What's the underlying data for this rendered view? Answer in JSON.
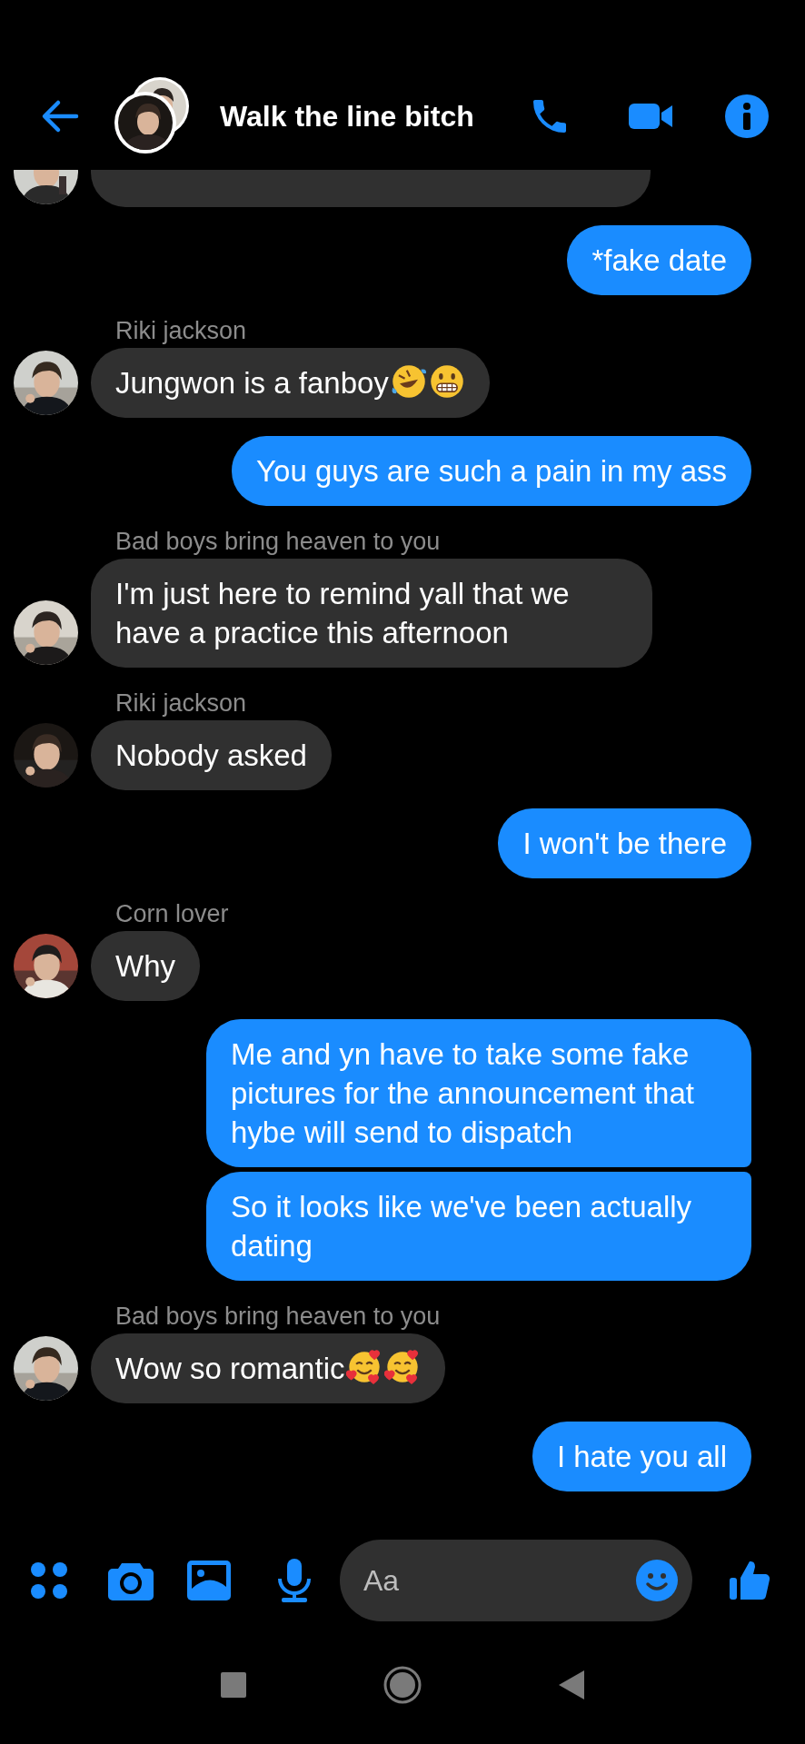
{
  "header": {
    "title": "Walk the line bitch"
  },
  "messages": [
    {
      "kind": "incoming",
      "cut_off": true
    },
    {
      "kind": "outgoing",
      "text": "*fake date"
    },
    {
      "kind": "incoming",
      "sender": "Riki jackson",
      "text": "Jungwon is a fanboy",
      "emojis": [
        {
          "kind": "rofl"
        },
        {
          "kind": "grimace"
        }
      ]
    },
    {
      "kind": "outgoing",
      "text": "You guys are such a pain in my ass"
    },
    {
      "kind": "incoming",
      "sender": "Bad boys bring heaven to you",
      "text": "I'm just here to remind yall that we have a practice this afternoon"
    },
    {
      "kind": "incoming",
      "sender": "Riki jackson",
      "text": "Nobody asked"
    },
    {
      "kind": "outgoing",
      "text": "I won't be there"
    },
    {
      "kind": "incoming",
      "sender": "Corn lover",
      "text": "Why"
    },
    {
      "kind": "outgoing",
      "text": "Me and yn have to take some fake pictures for the announcement that hybe will send to dispatch"
    },
    {
      "kind": "outgoing",
      "text": "So it looks like we've been actually dating"
    },
    {
      "kind": "incoming",
      "sender": "Bad boys bring heaven to you",
      "text": "Wow so romantic",
      "emojis": [
        {
          "kind": "hearts"
        },
        {
          "kind": "hearts"
        }
      ]
    },
    {
      "kind": "outgoing",
      "text": "I hate you all"
    }
  ],
  "composer": {
    "placeholder": "Aa"
  }
}
